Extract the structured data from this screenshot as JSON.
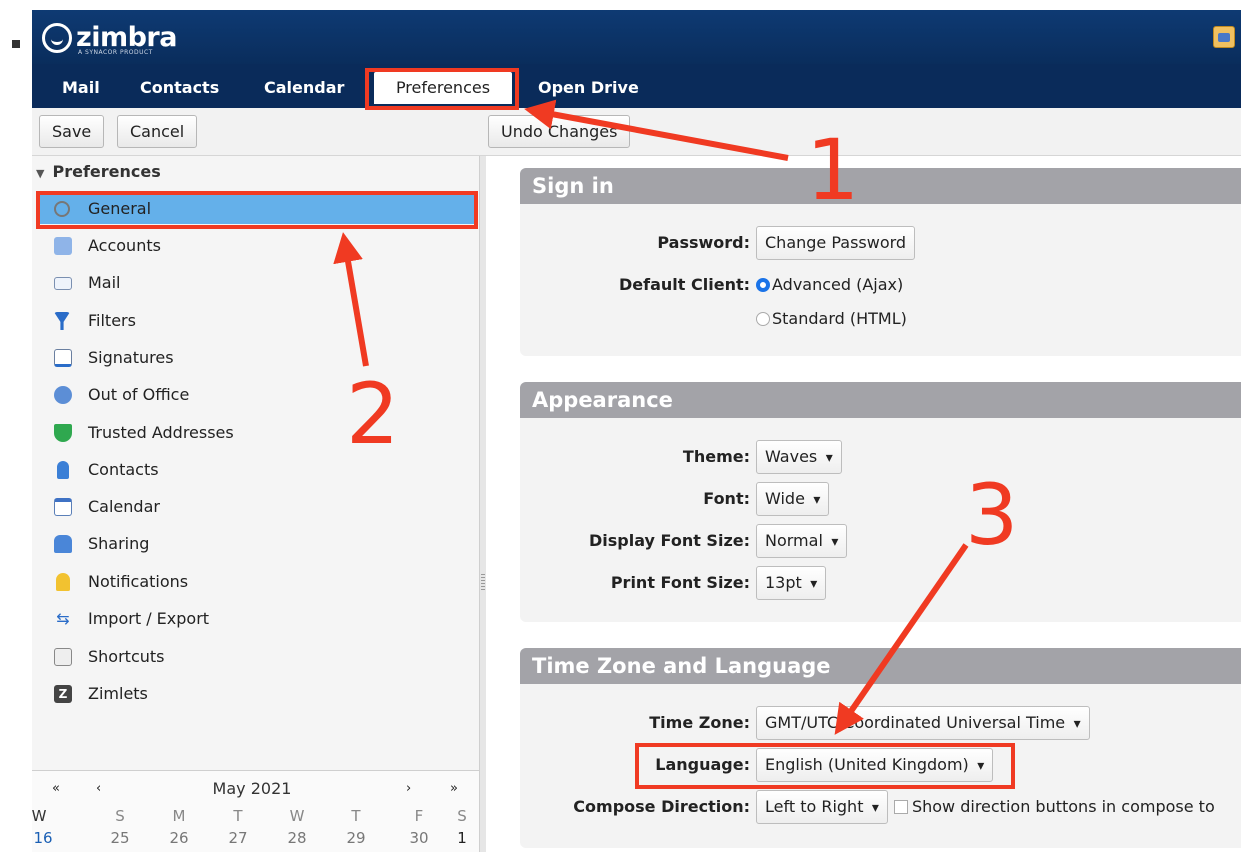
{
  "header": {
    "logo_text": "zimbra",
    "logo_tagline": "A SYNACOR PRODUCT"
  },
  "tabs": [
    {
      "label": "Mail"
    },
    {
      "label": "Contacts"
    },
    {
      "label": "Calendar"
    },
    {
      "label": "Preferences"
    },
    {
      "label": "Open Drive"
    }
  ],
  "toolbar": {
    "save_label": "Save",
    "cancel_label": "Cancel",
    "undo_label": "Undo Changes"
  },
  "tree": {
    "header": "Preferences",
    "items": [
      {
        "label": "General",
        "icon": "gear-icon"
      },
      {
        "label": "Accounts",
        "icon": "accounts-icon"
      },
      {
        "label": "Mail",
        "icon": "envelope-icon"
      },
      {
        "label": "Filters",
        "icon": "filter-icon"
      },
      {
        "label": "Signatures",
        "icon": "signature-icon"
      },
      {
        "label": "Out of Office",
        "icon": "out-of-office-icon"
      },
      {
        "label": "Trusted Addresses",
        "icon": "shield-check-icon"
      },
      {
        "label": "Contacts",
        "icon": "contact-icon"
      },
      {
        "label": "Calendar",
        "icon": "calendar-icon"
      },
      {
        "label": "Sharing",
        "icon": "sharing-icon"
      },
      {
        "label": "Notifications",
        "icon": "bell-icon"
      },
      {
        "label": "Import / Export",
        "icon": "import-export-icon"
      },
      {
        "label": "Shortcuts",
        "icon": "shortcut-key-icon"
      },
      {
        "label": "Zimlets",
        "icon": "zimlets-icon"
      }
    ]
  },
  "minical": {
    "title": "May 2021",
    "first_prev": "«",
    "prev": "‹",
    "next": "›",
    "last_next": "»",
    "week_label": "W",
    "day_headers": [
      "S",
      "M",
      "T",
      "W",
      "T",
      "F",
      "S"
    ],
    "week_number": "16",
    "days": [
      "25",
      "26",
      "27",
      "28",
      "29",
      "30",
      "1"
    ]
  },
  "sections": {
    "signin": {
      "title": "Sign in",
      "password_label": "Password:",
      "change_password": "Change Password",
      "default_client_label": "Default Client:",
      "option_advanced": "Advanced (Ajax)",
      "option_standard": "Standard (HTML)"
    },
    "appearance": {
      "title": "Appearance",
      "theme_label": "Theme:",
      "theme_value": "Waves",
      "font_label": "Font:",
      "font_value": "Wide",
      "display_size_label": "Display Font Size:",
      "display_size_value": "Normal",
      "print_size_label": "Print Font Size:",
      "print_size_value": "13pt"
    },
    "timezone": {
      "title": "Time Zone and Language",
      "tz_label": "Time Zone:",
      "tz_value": "GMT/UTC Coordinated Universal Time",
      "language_label": "Language:",
      "language_value": "English (United Kingdom)",
      "direction_label": "Compose Direction:",
      "direction_value": "Left to Right",
      "show_direction_label": "Show direction buttons in compose to"
    }
  },
  "annotations": {
    "n1": "1",
    "n2": "2",
    "n3": "3",
    "color": "#f03a22"
  },
  "colors": {
    "header_bg": "#0a2d5c",
    "selected_item": "#64b0ea",
    "section_header": "#a3a3a8"
  }
}
